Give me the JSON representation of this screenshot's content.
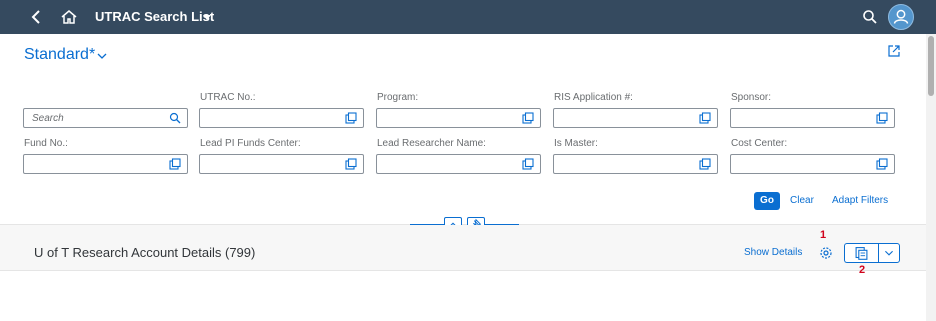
{
  "shell": {
    "title": "UTRAC Search List"
  },
  "variant": {
    "name": "Standard*"
  },
  "filters": {
    "search_placeholder": "Search",
    "row1": [
      {
        "label": "UTRAC No.:",
        "value": ""
      },
      {
        "label": "Program:",
        "value": ""
      },
      {
        "label": "RIS Application #:",
        "value": ""
      },
      {
        "label": "Sponsor:",
        "value": ""
      }
    ],
    "row2": [
      {
        "label": "Fund No.:",
        "value": ""
      },
      {
        "label": "Lead PI Funds Center:",
        "value": ""
      },
      {
        "label": "Lead Researcher Name:",
        "value": ""
      },
      {
        "label": "Is Master:",
        "value": ""
      },
      {
        "label": "Cost Center:",
        "value": ""
      }
    ]
  },
  "actions": {
    "go": "Go",
    "clear": "Clear",
    "adapt": "Adapt Filters"
  },
  "table": {
    "title": "U of T Research Account Details (799)",
    "show_details": "Show Details"
  },
  "annotations": {
    "one": "1",
    "two": "2"
  },
  "colors": {
    "shell": "#354a5f",
    "accent": "#0a6ed1",
    "callout": "#d0021b"
  }
}
